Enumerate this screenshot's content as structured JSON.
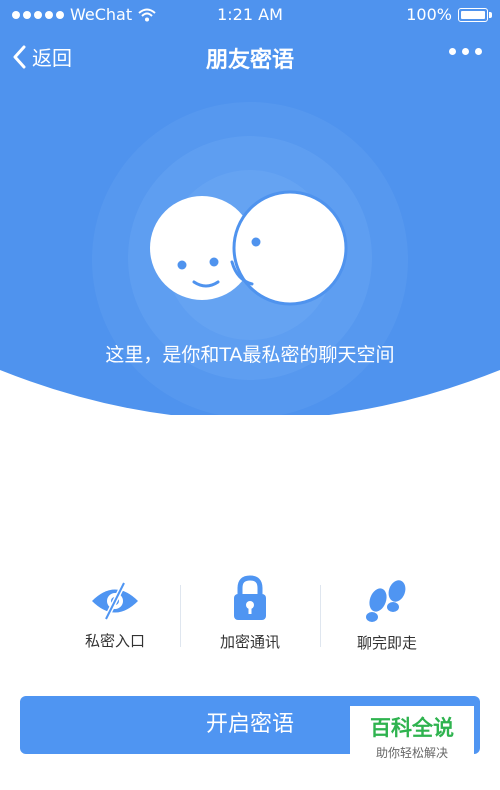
{
  "status_bar": {
    "carrier": "WeChat",
    "time": "1:21 AM",
    "battery": "100%"
  },
  "nav": {
    "back_label": "返回",
    "title": "朋友密语"
  },
  "hero": {
    "tagline": "这里，是你和TA最私密的聊天空间"
  },
  "features": [
    {
      "label": "私密入口",
      "icon": "eye-slash-icon"
    },
    {
      "label": "加密通讯",
      "icon": "lock-icon"
    },
    {
      "label": "聊完即走",
      "icon": "footprints-icon"
    }
  ],
  "start_button": {
    "label": "开启密语"
  },
  "watermark": {
    "title": "百科全说",
    "subtitle": "助你轻松解决"
  },
  "colors": {
    "accent": "#4f95f2",
    "hero_bg": "#4f93ee",
    "icon_blue": "#4f95f2",
    "watermark_green": "#2fb34f"
  }
}
